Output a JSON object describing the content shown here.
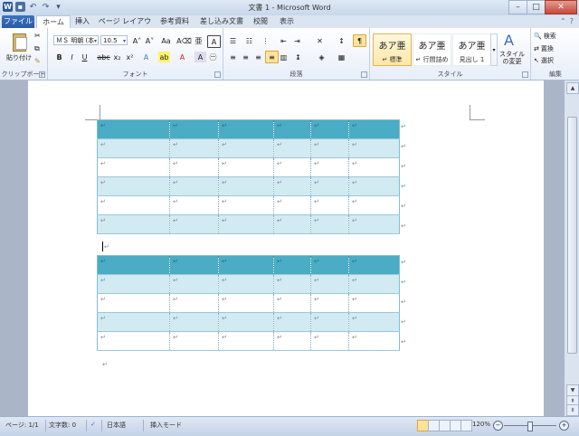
{
  "title": "文書 1 - Microsoft Word",
  "tabs": [
    "ファイル",
    "ホーム",
    "挿入",
    "ページ レイアウト",
    "参考資料",
    "差し込み文書",
    "校閲",
    "表示"
  ],
  "window_controls": {
    "minimize": "–",
    "maximize": "□",
    "close": "✕"
  },
  "ribbon": {
    "clipboard": {
      "paste": "貼り付け",
      "label": "クリップボード"
    },
    "font": {
      "name": "ＭＳ 明朝 (本",
      "size": "10.5",
      "label": "フォント"
    },
    "paragraph": {
      "label": "段落"
    },
    "styles": {
      "items": [
        {
          "sample": "あア亜",
          "name": "↵ 標準"
        },
        {
          "sample": "あア亜",
          "name": "↵ 行間詰め"
        },
        {
          "sample": "あア亜",
          "name": "見出し 1"
        }
      ],
      "change": "スタイルの変更",
      "label": "スタイル"
    },
    "editing": {
      "find": "検索",
      "replace": "置換",
      "select": "選択",
      "label": "編集"
    }
  },
  "document": {
    "paragraph_mark": "↵"
  },
  "status": {
    "page": "ページ: 1/1",
    "words": "文字数: 0",
    "language": "日本語",
    "mode": "挿入モード",
    "zoom": "120%"
  },
  "colors": {
    "header": "#4aacc5",
    "band": "#d2eaf1",
    "accent": "#2b5797"
  }
}
